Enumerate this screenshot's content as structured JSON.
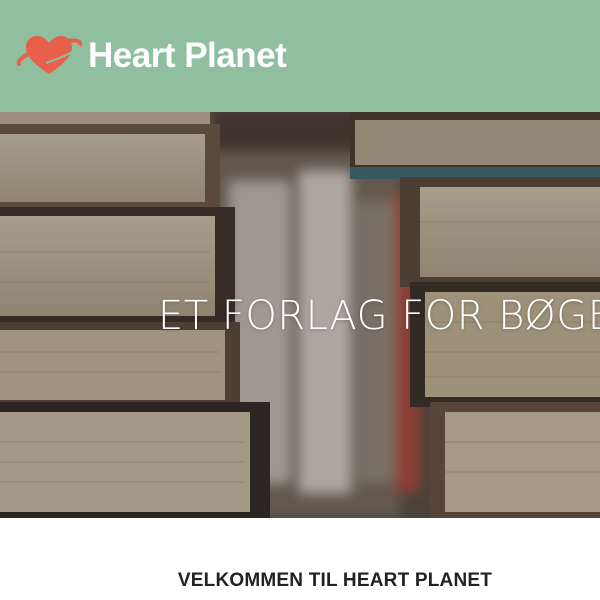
{
  "header": {
    "brand_name": "Heart Planet",
    "logo_icon": "heart-planet-icon",
    "background_color": "#8fbf9f",
    "logo_color": "#e8604c"
  },
  "hero": {
    "title": "ET FORLAG FOR BØGER",
    "image": "stacked-books-photo"
  },
  "main": {
    "welcome_heading": "VELKOMMEN TIL HEART PLANET"
  }
}
